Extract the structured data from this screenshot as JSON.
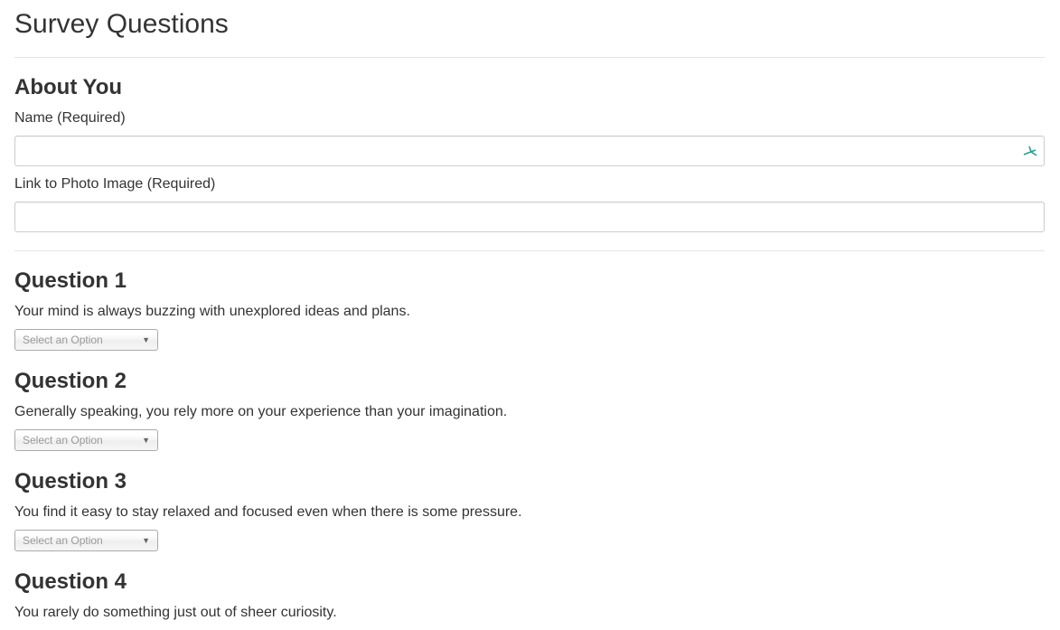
{
  "page": {
    "title": "Survey Questions"
  },
  "about": {
    "heading": "About You",
    "name_label": "Name (Required)",
    "name_value": "",
    "photo_label": "Link to Photo Image (Required)",
    "photo_value": ""
  },
  "questions": [
    {
      "heading": "Question 1",
      "text": "Your mind is always buzzing with unexplored ideas and plans.",
      "select_placeholder": "Select an Option"
    },
    {
      "heading": "Question 2",
      "text": "Generally speaking, you rely more on your experience than your imagination.",
      "select_placeholder": "Select an Option"
    },
    {
      "heading": "Question 3",
      "text": "You find it easy to stay relaxed and focused even when there is some pressure.",
      "select_placeholder": "Select an Option"
    },
    {
      "heading": "Question 4",
      "text": "You rarely do something just out of sheer curiosity."
    }
  ],
  "icons": {
    "name_field_icon": "autofill-icon",
    "select_arrow": "chevron-down-icon"
  },
  "colors": {
    "text": "#333333",
    "divider": "#e5e5e5",
    "input_border": "#cccccc",
    "placeholder": "#999999",
    "autofill_icon": "#2a9d8f"
  }
}
